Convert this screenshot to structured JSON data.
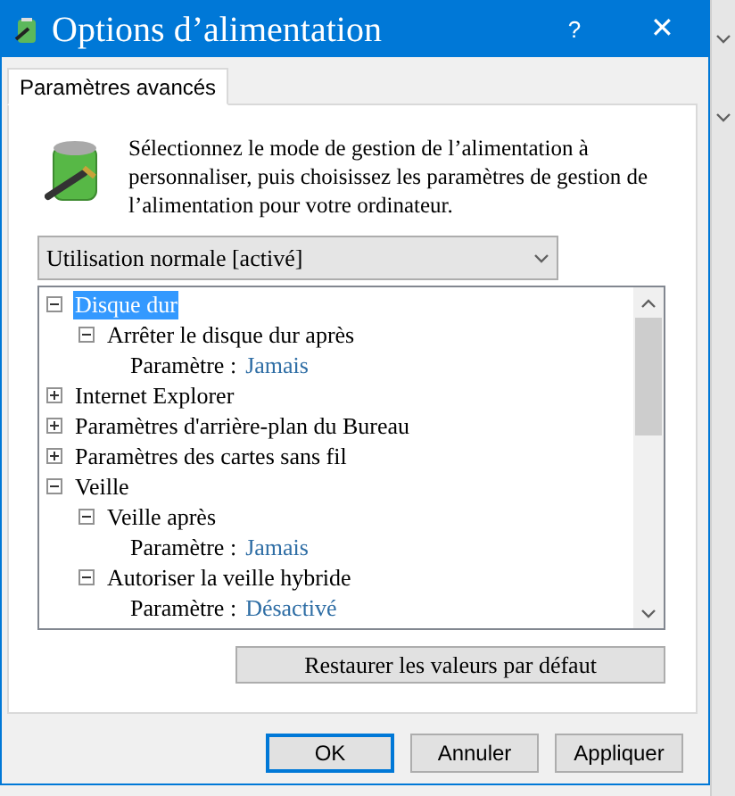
{
  "window": {
    "title": "Options d’alimentation",
    "help": "?",
    "close": "✕"
  },
  "tabs": [
    {
      "label": "Paramètres avancés",
      "selected": true
    }
  ],
  "description": "Sélectionnez le mode de gestion de l’alimentation à personnaliser, puis choisissez les paramètres de gestion de l’alimentation pour votre ordinateur.",
  "plan_dropdown": {
    "value": "Utilisation normale [activé]"
  },
  "tree": [
    {
      "label": "Disque dur",
      "expanded": true,
      "selected": true,
      "children": [
        {
          "label": "Arrêter le disque dur après",
          "expanded": true,
          "selected": false,
          "children": [
            {
              "kind": "setting",
              "label": "Paramètre :",
              "value": "Jamais"
            }
          ]
        }
      ]
    },
    {
      "label": "Internet Explorer",
      "expanded": false,
      "selected": false
    },
    {
      "label": "Paramètres d'arrière-plan du Bureau",
      "expanded": false,
      "selected": false
    },
    {
      "label": "Paramètres des cartes sans fil",
      "expanded": false,
      "selected": false
    },
    {
      "label": "Veille",
      "expanded": true,
      "selected": false,
      "children": [
        {
          "label": "Veille après",
          "expanded": true,
          "selected": false,
          "children": [
            {
              "kind": "setting",
              "label": "Paramètre :",
              "value": "Jamais"
            }
          ]
        },
        {
          "label": "Autoriser la veille hybride",
          "expanded": true,
          "selected": false,
          "children": [
            {
              "kind": "setting",
              "label": "Paramètre :",
              "value": "Désactivé"
            }
          ]
        }
      ]
    }
  ],
  "restore_button": "Restaurer les valeurs par défaut",
  "buttons": [
    {
      "label": "OK",
      "focused": true
    },
    {
      "label": "Annuler",
      "focused": false
    },
    {
      "label": "Appliquer",
      "focused": false
    }
  ]
}
